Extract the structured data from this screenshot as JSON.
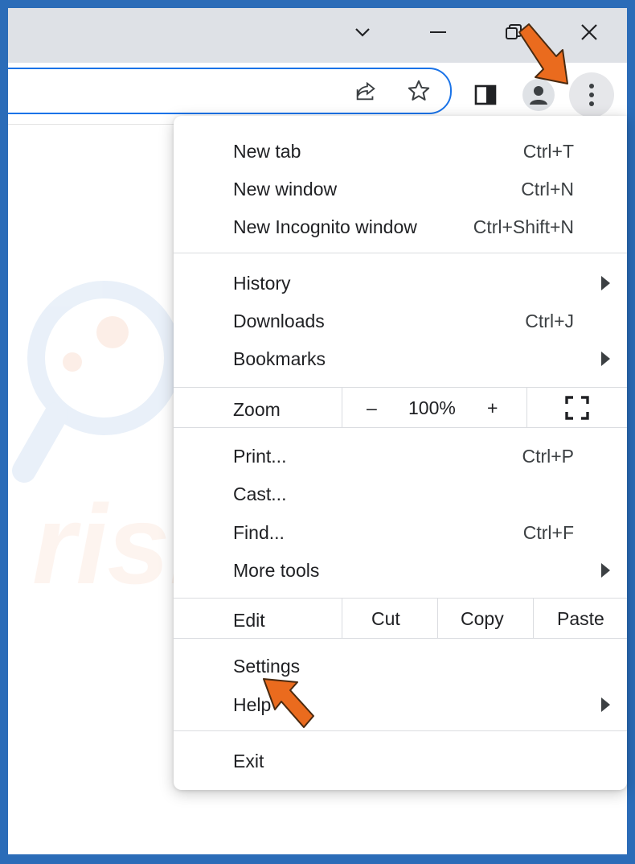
{
  "window_controls": {
    "minimize_icon": "minimize-icon",
    "restore_icon": "restore-icon",
    "close_icon": "close-icon",
    "tab_search_icon": "chevron-down-icon"
  },
  "toolbar": {
    "share_icon": "share-icon",
    "bookmark_icon": "star-icon",
    "side_panel_icon": "side-panel-icon",
    "profile_icon": "person-icon",
    "menu_icon": "three-dots-vertical-icon"
  },
  "menu": {
    "new_tab": {
      "label": "New tab",
      "shortcut": "Ctrl+T"
    },
    "new_window": {
      "label": "New window",
      "shortcut": "Ctrl+N"
    },
    "new_incognito": {
      "label": "New Incognito window",
      "shortcut": "Ctrl+Shift+N"
    },
    "history": {
      "label": "History"
    },
    "downloads": {
      "label": "Downloads",
      "shortcut": "Ctrl+J"
    },
    "bookmarks": {
      "label": "Bookmarks"
    },
    "zoom": {
      "label": "Zoom",
      "minus": "–",
      "value": "100%",
      "plus": "+",
      "fullscreen_icon": "fullscreen-icon"
    },
    "print": {
      "label": "Print...",
      "shortcut": "Ctrl+P"
    },
    "cast": {
      "label": "Cast..."
    },
    "find": {
      "label": "Find...",
      "shortcut": "Ctrl+F"
    },
    "more_tools": {
      "label": "More tools"
    },
    "edit": {
      "label": "Edit",
      "cut": "Cut",
      "copy": "Copy",
      "paste": "Paste"
    },
    "settings": {
      "label": "Settings"
    },
    "help": {
      "label": "Help"
    },
    "exit": {
      "label": "Exit"
    }
  },
  "annotations": {
    "arrow_color": "#ea6b1e",
    "watermark_text": "PC risk.com"
  },
  "colors": {
    "frame": "#2b6cb8",
    "titlebar": "#dee1e6",
    "focus_ring": "#1a73e8",
    "separator": "#dadce0"
  }
}
